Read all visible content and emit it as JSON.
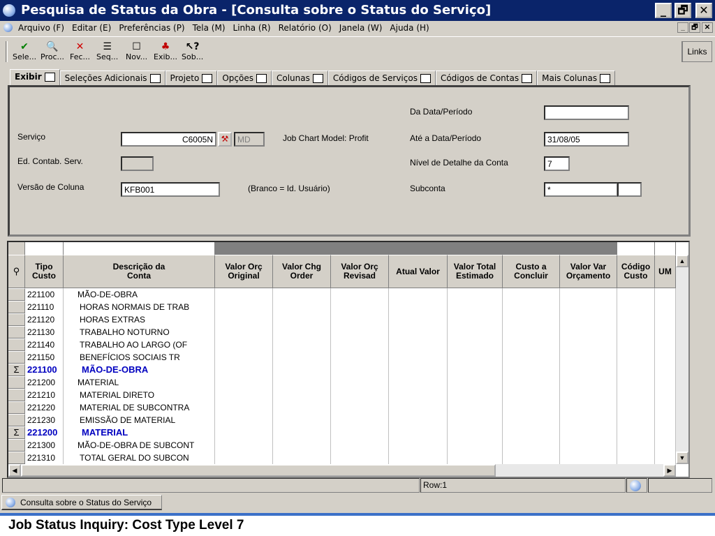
{
  "window": {
    "title": "Pesquisa de Status da Obra - [Consulta sobre o Status do Serviço]",
    "controls": [
      "_",
      "🗗",
      "✕"
    ]
  },
  "menu": {
    "items": [
      "Arquivo (F)",
      "Editar (E)",
      "Preferências (P)",
      "Tela (M)",
      "Linha (R)",
      "Relatório (O)",
      "Janela (W)",
      "Ajuda (H)"
    ],
    "mdi_controls": [
      "_",
      "🗗",
      "✕"
    ]
  },
  "toolbar": {
    "buttons": [
      {
        "icon": "check-icon",
        "glyph": "✔",
        "color": "#008000",
        "label": "Sele..."
      },
      {
        "icon": "find-icon",
        "glyph": "🔍",
        "color": "#000000",
        "label": "Proc..."
      },
      {
        "icon": "close-icon",
        "glyph": "✕",
        "color": "#d00000",
        "label": "Fec..."
      },
      {
        "icon": "sequence-icon",
        "glyph": "☰",
        "color": "#000000",
        "label": "Seq..."
      },
      {
        "icon": "new-icon",
        "glyph": "☐",
        "color": "#000000",
        "label": "Nov..."
      },
      {
        "icon": "display-icon",
        "glyph": "♣",
        "color": "#c00000",
        "label": "Exib..."
      },
      {
        "icon": "about-icon",
        "glyph": "↖?",
        "color": "#000000",
        "label": "Sob..."
      }
    ],
    "links_label": "Links"
  },
  "tabs": [
    {
      "label": "Exibir",
      "active": true
    },
    {
      "label": "Seleções Adicionais",
      "active": false
    },
    {
      "label": "Projeto",
      "active": false
    },
    {
      "label": "Opções",
      "active": false
    },
    {
      "label": "Colunas",
      "active": false
    },
    {
      "label": "Códigos de Serviços",
      "active": false
    },
    {
      "label": "Códigos de Contas",
      "active": false
    },
    {
      "label": "Mais Colunas",
      "active": false
    }
  ],
  "form": {
    "servico_label": "Serviço",
    "servico_value": "C6005N",
    "servico_suffix": "MD",
    "ed_contab_label": "Ed. Contab. Serv.",
    "ed_contab_value": "",
    "versao_label": "Versão de Coluna",
    "versao_value": "KFB001",
    "job_chart_text": "Job Chart Model: Profit",
    "branco_text": "(Branco = Id. Usuário)",
    "da_data_label": "Da Data/Período",
    "da_data_value": "",
    "ate_data_label": "Até a Data/Período",
    "ate_data_value": "31/08/05",
    "nivel_label": "Nível de Detalhe da Conta",
    "nivel_value": "7",
    "subconta_label": "Subconta",
    "subconta_value": "*",
    "subconta_value2": ""
  },
  "grid": {
    "columns": [
      "Tipo\nCusto",
      "Descrição da\nConta",
      "Valor Orç\nOriginal",
      "Valor Chg\nOrder",
      "Valor Orç\nRevisad",
      "Atual Valor",
      "Valor Total\nEstimado",
      "Custo a\nConcluir",
      "Valor Var\nOrçamento",
      "Código\nCusto",
      "UM"
    ],
    "rows": [
      {
        "marker": "",
        "code": "221100",
        "desc": "MÃO-DE-OBRA",
        "summary": false
      },
      {
        "marker": "",
        "code": "221110",
        "desc": "HORAS NORMAIS DE TRAB",
        "summary": false
      },
      {
        "marker": "",
        "code": "221120",
        "desc": "HORAS EXTRAS",
        "summary": false
      },
      {
        "marker": "",
        "code": "221130",
        "desc": "TRABALHO NOTURNO",
        "summary": false
      },
      {
        "marker": "",
        "code": "221140",
        "desc": "TRABALHO AO LARGO (OF",
        "summary": false
      },
      {
        "marker": "",
        "code": "221150",
        "desc": "BENEFÍCIOS SOCIAIS TR",
        "summary": false
      },
      {
        "marker": "Σ",
        "code": "221100",
        "desc": "MÃO-DE-OBRA",
        "summary": true
      },
      {
        "marker": "",
        "code": "221200",
        "desc": "MATERIAL",
        "summary": false
      },
      {
        "marker": "",
        "code": "221210",
        "desc": "MATERIAL DIRETO",
        "summary": false
      },
      {
        "marker": "",
        "code": "221220",
        "desc": "MATERIAL DE SUBCONTRA",
        "summary": false
      },
      {
        "marker": "",
        "code": "221230",
        "desc": "EMISSÃO DE MATERIAL",
        "summary": false
      },
      {
        "marker": "Σ",
        "code": "221200",
        "desc": "MATERIAL",
        "summary": true
      },
      {
        "marker": "",
        "code": "221300",
        "desc": "MÃO-DE-OBRA DE SUBCONT",
        "summary": false
      },
      {
        "marker": "",
        "code": "221310",
        "desc": "TOTAL GERAL DO SUBCON",
        "summary": false
      }
    ],
    "summary_color": "#0000c0"
  },
  "status": {
    "row_text": "Row:1"
  },
  "taskbar": {
    "tab_label": "Consulta sobre o Status do Serviço"
  },
  "caption": "Job Status Inquiry: Cost Type Level 7",
  "colors": {
    "titlebar": "#0a246a",
    "chrome": "#d4d0c8",
    "accent_rule": "#3b70c8"
  }
}
